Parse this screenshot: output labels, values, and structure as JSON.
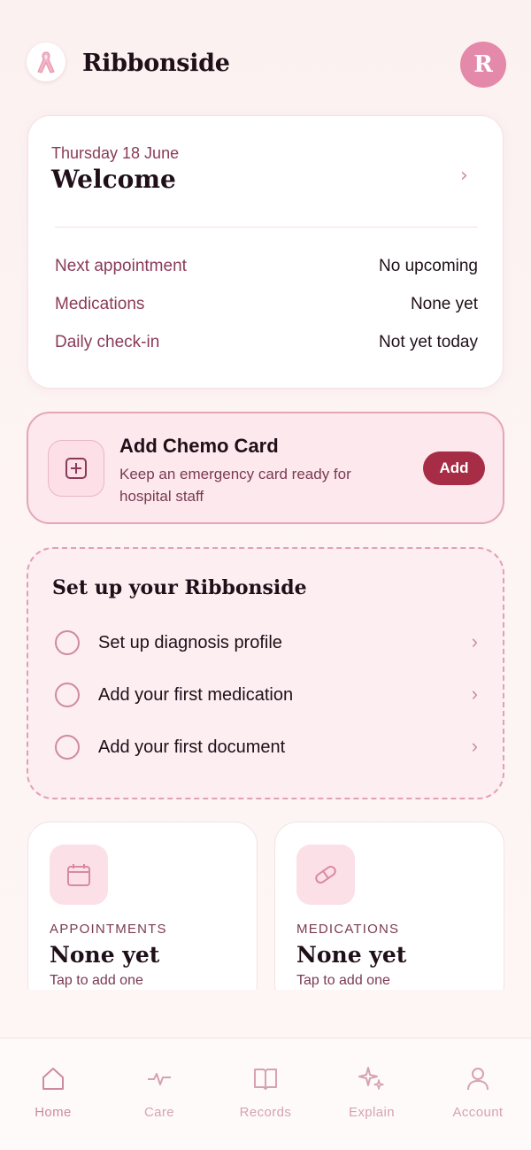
{
  "app": {
    "title": "Ribbonside",
    "avatar_initial": "R",
    "logo_icon": "pink-ribbon-icon"
  },
  "welcome": {
    "date": "Thursday 18 June",
    "title": "Welcome",
    "rows": [
      {
        "label": "Next appointment",
        "value": "No upcoming"
      },
      {
        "label": "Medications",
        "value": "None yet"
      },
      {
        "label": "Daily check-in",
        "value": "Not yet today"
      }
    ]
  },
  "chemo": {
    "title": "Add Chemo Card",
    "subtitle": "Keep an emergency card ready for hospital staff",
    "button": "Add"
  },
  "setup": {
    "title": "Set up your Ribbonside",
    "tasks": [
      {
        "label": "Set up diagnosis profile"
      },
      {
        "label": "Add your first medication"
      },
      {
        "label": "Add your first document"
      }
    ]
  },
  "tiles": [
    {
      "kicker": "APPOINTMENTS",
      "value": "None yet",
      "sub": "Tap to add one",
      "icon": "calendar-icon"
    },
    {
      "kicker": "MEDICATIONS",
      "value": "None yet",
      "sub": "Tap to add one",
      "icon": "pill-icon"
    }
  ],
  "tabs": [
    {
      "label": "Home",
      "icon": "home-icon"
    },
    {
      "label": "Care",
      "icon": "pulse-icon"
    },
    {
      "label": "Records",
      "icon": "book-icon"
    },
    {
      "label": "Explain",
      "icon": "sparkle-icon"
    },
    {
      "label": "Account",
      "icon": "user-icon"
    }
  ],
  "colors": {
    "accent": "#a62d45",
    "avatar": "#e489a9",
    "label": "#8a3a58"
  }
}
